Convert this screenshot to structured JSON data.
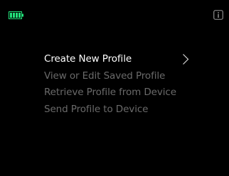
{
  "status_bar": {
    "battery_icon": "battery-full-icon",
    "battery_color": "#22e17a",
    "info_icon": "info-icon"
  },
  "menu": {
    "items": [
      {
        "label": "Create New Profile",
        "selected": true
      },
      {
        "label": "View or Edit Saved Profile",
        "selected": false
      },
      {
        "label": "Retrieve Profile from Device",
        "selected": false
      },
      {
        "label": "Send Profile to Device",
        "selected": false
      }
    ],
    "selected_indicator_icon": "chevron-right-icon",
    "colors": {
      "selected_text": "#ffffff",
      "unselected_text": "#6a6a6a"
    }
  }
}
